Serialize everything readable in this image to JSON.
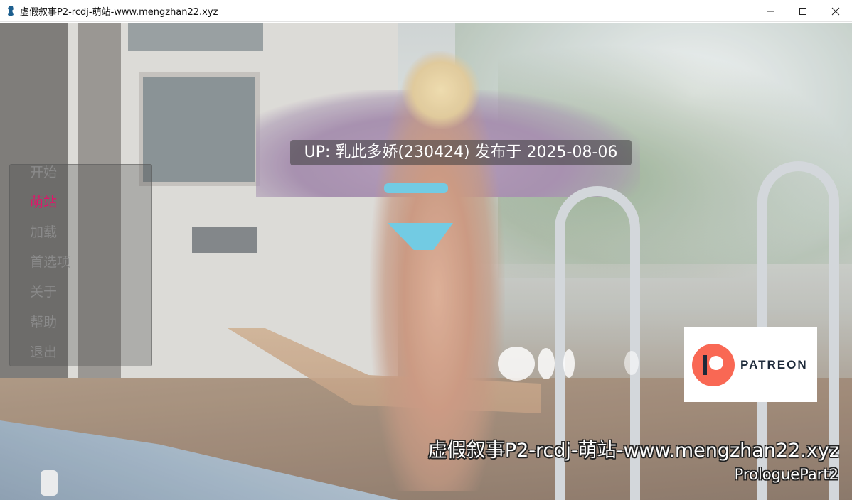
{
  "window": {
    "title": "虚假叙事P2-rcdj-萌站-www.mengzhan22.xyz",
    "controls": [
      "minimize-icon",
      "maximize-icon",
      "close-icon"
    ]
  },
  "notice": {
    "text": "UP: 乳此多娇(230424) 发布于 2025-08-06"
  },
  "menu": {
    "items": [
      {
        "label": "开始",
        "active": false
      },
      {
        "label": "萌站",
        "active": true
      },
      {
        "label": "加载",
        "active": false
      },
      {
        "label": "首选项",
        "active": false
      },
      {
        "label": "关于",
        "active": false
      },
      {
        "label": "帮助",
        "active": false
      },
      {
        "label": "退出",
        "active": false
      }
    ],
    "active_color": "#e0156a",
    "inactive_color": "#8a8a8a"
  },
  "patreon": {
    "label": "PATREON",
    "logo_color": "#f96854"
  },
  "watermark": {
    "text": "虚假叙事P2-rcdj-萌站-www.mengzhan22.xyz",
    "version": "ProloguePart2"
  }
}
